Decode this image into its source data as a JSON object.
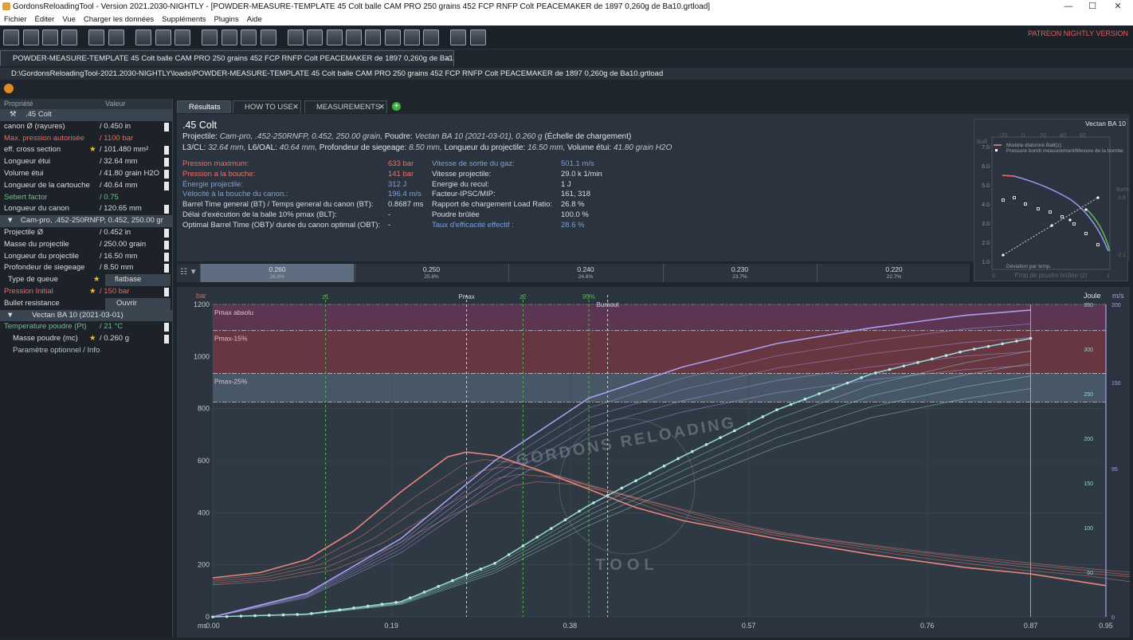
{
  "window": {
    "title": "GordonsReloadingTool - Version 2021.2030-NIGHTLY - [POWDER-MEASURE-TEMPLATE 45 Colt balle CAM PRO 250 grains 452 FCP RNFP Colt PEACEMAKER de 1897 0,260g de Ba10.grtload]"
  },
  "menu": [
    "Fichier",
    "Éditer",
    "Vue",
    "Charger les données",
    "Suppléments",
    "Plugins",
    "Aide"
  ],
  "patreon": "PATREON NIGHTLY VERSION",
  "doc_tab": "POWDER-MEASURE-TEMPLATE 45 Colt balle CAM PRO 250 grains 452 FCP RNFP Colt PEACEMAKER de 1897 0,260g de Ba10",
  "file_path": "D:\\GordonsReloadingTool-2021.2030-NIGHTLY\\loads\\POWDER-MEASURE-TEMPLATE 45 Colt balle CAM PRO 250 grains 452 FCP RNFP Colt PEACEMAKER de 1897 0,260g de Ba10.grtload",
  "props": {
    "hdr_prop": "Propriété",
    "hdr_val": "Valeur",
    "g1": ".45 Colt",
    "r1": [
      "canon Ø (rayures)",
      "/ 0.450 in"
    ],
    "r2": [
      "Max. pression autorisée",
      "/ 1100 bar"
    ],
    "r3": [
      "eff. cross section",
      "/ 101.480 mm²"
    ],
    "r4": [
      "Longueur étui",
      "/ 32.64 mm"
    ],
    "r5": [
      "Volume étui",
      "/ 41.80 grain H2O"
    ],
    "r6": [
      "Longueur de la cartouche",
      "/ 40.64 mm"
    ],
    "r7": [
      "Sebert factor",
      "/ 0.75"
    ],
    "r8": [
      "Longueur du canon",
      "/ 120.65 mm"
    ],
    "g2": "Cam-pro, .452-250RNFP, 0.452, 250.00 gr",
    "r9": [
      "Projectile Ø",
      "/ 0.452 in"
    ],
    "r10": [
      "Masse du projectile",
      "/ 250.00 grain"
    ],
    "r11": [
      "Longueur du projectile",
      "/ 16.50 mm"
    ],
    "r12": [
      "Profondeur de siegeage",
      "/ 8.50 mm"
    ],
    "r13": [
      "Type de queue",
      "flatbase"
    ],
    "r14": [
      "Pression Initial",
      "/ 150 bar"
    ],
    "r15": [
      "Bullet resistance",
      "Ouvrir"
    ],
    "g3": "Vectan BA 10 (2021-03-01)",
    "r16": [
      "Temperature poudre (Pt)",
      "/ 21 °C"
    ],
    "r17": [
      "Masse poudre (mc)",
      "/ 0.260 g"
    ],
    "r18": "Paramètre optionnel / Info"
  },
  "tabs": [
    "Résultats",
    "HOW TO USE",
    "MEASUREMENTS"
  ],
  "results": {
    "title": ".45 Colt",
    "proj_label": "Projectile:",
    "proj_val": "Cam-pro, .452-250RNFP, 0.452, 250.00 grain,",
    "powder_label": "Poudre:",
    "powder_val": "Vectan BA 10 (2021-03-01), 0.260 g",
    "powder_tail": "(Échelle de chargement)",
    "l3_label": "L3/CL:",
    "l3_val": "32.64 mm,",
    "l6_label": "L6/OAL:",
    "l6_val": "40.64 mm,",
    "seat_label": "Profondeur de siegeage:",
    "seat_val": "8.50 mm,",
    "plen_label": "Longueur du projectile:",
    "plen_val": "16.50 mm,",
    "vol_label": "Volume étui:",
    "vol_val": "41.80 grain H2O",
    "stats": [
      [
        "Pression maximum:",
        "633 bar",
        "Vitesse de sortie du gaz:",
        "501.1 m/s"
      ],
      [
        "Pression a la bouche:",
        "141 bar",
        "Vitesse projectile:",
        "29.0 k 1/min"
      ],
      [
        "Énergie projectile:",
        "312 J",
        "Energie du recul:",
        "1 J"
      ],
      [
        "Vélocité à la bouche du canon.:",
        "196.4 m/s",
        "Facteur-IPSC/MIP:",
        "161, 318"
      ],
      [
        "Barrel Time general (BT) / Temps general du canon (BT):",
        "0.8687 ms",
        "Rapport de chargement Load Ratio:",
        "26.8 %"
      ],
      [
        "Délai d'exécution de la balle 10% pmax (BLT):",
        "-",
        "Poudre brûlée",
        "100.0 %"
      ],
      [
        "Optimal Barrel Time (OBT)/ durée du canon optimal (OBT):",
        "-",
        "Taux d'efficacité effectif :",
        "28.6 %"
      ]
    ]
  },
  "mini": {
    "title": "Vectan BA 10",
    "legend1": "Modèle étalonné Baθ(z)",
    "legend2": "Pressure bomb measurement/Mesure de la bombe",
    "legend3": "Déviation par temp.",
    "xlabel": "Prop.de poudre brûlée (z)",
    "top_ticks": [
      "-20",
      "0",
      "20",
      "40",
      "60"
    ],
    "y_ticks": [
      "7.0",
      "6.0",
      "5.0",
      "4.0",
      "3.0",
      "2.0",
      "1.0"
    ],
    "x_ticks": [
      "0",
      "1"
    ],
    "ylab": "Baθ",
    "ylab2": "Ba%",
    "r1": "3.8",
    "r2": "-2.1"
  },
  "load_ladder": [
    {
      "g": "0.260",
      "p": "26.8%"
    },
    {
      "g": "0.250",
      "p": "25.8%"
    },
    {
      "g": "0.240",
      "p": "24.8%"
    },
    {
      "g": "0.230",
      "p": "23.7%"
    },
    {
      "g": "0.220",
      "p": "22.7%"
    }
  ],
  "chart_data": {
    "type": "line",
    "x_unit": "ms",
    "x_ticks": [
      "0.00",
      "0.19",
      "0.38",
      "0.57",
      "0.76",
      "0.87",
      "0.95"
    ],
    "left_axis": {
      "label": "bar",
      "ticks": [
        0,
        200,
        400,
        600,
        800,
        1000,
        1200
      ],
      "range": [
        0,
        1200
      ]
    },
    "right_axis_joule": {
      "label": "Joule",
      "ticks": [
        50,
        100,
        150,
        200,
        250,
        300,
        350
      ],
      "range": [
        0,
        350
      ]
    },
    "right_axis_ms": {
      "label": "m/s",
      "ticks": [
        0,
        95,
        150,
        200
      ],
      "range": [
        0,
        200
      ]
    },
    "bands": [
      {
        "label": "Pmax absolu",
        "from": 1100,
        "to": 1200,
        "color": "#5e3552"
      },
      {
        "label": "Pmax-15%",
        "from": 935,
        "to": 1100,
        "color": "#6a3640"
      },
      {
        "label": "Pmax-25%",
        "from": 825,
        "to": 935,
        "color": "#4a5869"
      }
    ],
    "markers": [
      {
        "label": "z1",
        "x": 0.12,
        "color": "#5fae5a"
      },
      {
        "label": "Pmax",
        "x": 0.27,
        "color": "#cfd4da"
      },
      {
        "label": "z2",
        "x": 0.33,
        "color": "#5fae5a"
      },
      {
        "label": "95%",
        "x": 0.4,
        "color": "#5fae5a"
      },
      {
        "label": "Burnout",
        "x": 0.42,
        "color": "#cfd4da"
      }
    ],
    "series": [
      {
        "name": "",
        "axis": "bar",
        "x": [
          0,
          0.05,
          0.1,
          0.15,
          0.2,
          0.25,
          0.27,
          0.3,
          0.35,
          0.4,
          0.45,
          0.5,
          0.6,
          0.7,
          0.8,
          0.87,
          0.95
        ],
        "values": [
          150,
          170,
          220,
          330,
          480,
          615,
          633,
          620,
          560,
          490,
          420,
          370,
          300,
          240,
          190,
          165,
          120
        ]
      },
      {
        "name": "",
        "axis": "ms",
        "x": [
          0,
          0.1,
          0.2,
          0.3,
          0.4,
          0.5,
          0.6,
          0.7,
          0.8,
          0.87
        ],
        "values": [
          0,
          15,
          50,
          100,
          140,
          160,
          175,
          185,
          193,
          196.4
        ]
      },
      {
        "name": "",
        "axis": "joule",
        "x": [
          0,
          0.1,
          0.2,
          0.3,
          0.4,
          0.5,
          0.6,
          0.7,
          0.8,
          0.87
        ],
        "values": [
          0,
          3,
          17,
          60,
          125,
          180,
          232,
          272,
          298,
          312
        ]
      }
    ]
  },
  "watermark": {
    "top": "GORDONS RELOADING",
    "bottom": "TOOL"
  },
  "colors": {
    "pressure": "#e8857c",
    "velocity": "#a99ff0",
    "energy": "#8fd6cf",
    "bg": "#2b343e"
  }
}
